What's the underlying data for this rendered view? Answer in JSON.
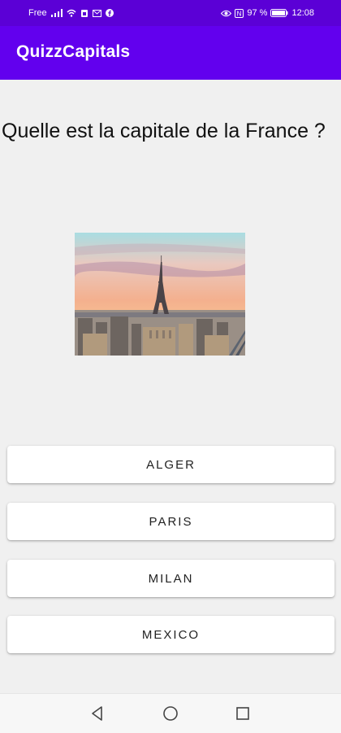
{
  "status_bar": {
    "carrier": "Free",
    "battery_percent": "97 %",
    "time": "12:08",
    "icons": [
      "signal-icon",
      "wifi-icon",
      "sim-icon",
      "mail-icon",
      "facebook-icon",
      "eye-icon",
      "nfc-icon",
      "battery-icon"
    ]
  },
  "app_bar": {
    "title": "QuizzCapitals"
  },
  "question": {
    "text": "Quelle est la capitale de la France ?"
  },
  "answers": [
    {
      "label": "ALGER"
    },
    {
      "label": "PARIS"
    },
    {
      "label": "MILAN"
    },
    {
      "label": "MEXICO"
    }
  ],
  "nav_bar": {
    "icons": [
      "back-icon",
      "home-icon",
      "recents-icon"
    ]
  },
  "colors": {
    "status_bar": "#5b00d6",
    "app_bar": "#6200ee",
    "background": "#f0f0f0"
  }
}
